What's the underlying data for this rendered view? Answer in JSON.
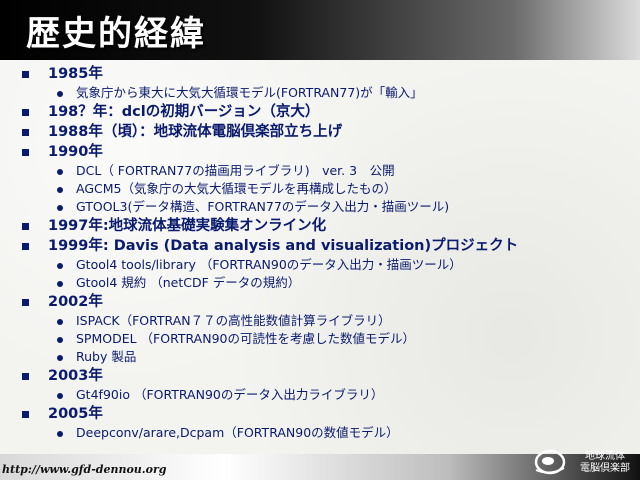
{
  "title": "歴史的経緯",
  "items": [
    {
      "label": "1985年",
      "sub": [
        "気象庁から東大に大気大循環モデル(FORTRAN77)が「輸入」"
      ]
    },
    {
      "label": "198？年：dclの初期バージョン（京大）",
      "sub": []
    },
    {
      "label": "1988年（頃）：地球流体電脳倶楽部立ち上げ",
      "sub": []
    },
    {
      "label": "1990年",
      "sub": [
        "DCL（ FORTRAN77の描画用ライブラリ)　ver. 3　公開",
        "AGCM5（気象庁の大気大循環モデルを再構成したもの）",
        "GTOOL3(データ構造、FORTRAN77のデータ入出力・描画ツール)"
      ]
    },
    {
      "label": "1997年:地球流体基礎実験集オンライン化",
      "sub": []
    },
    {
      "label": "1999年: Davis (Data analysis and visualization)プロジェクト",
      "sub": [
        "Gtool4 tools/library （FORTRAN90のデータ入出力・描画ツール）",
        "Gtool4 規約 （netCDF データの規約）"
      ]
    },
    {
      "label": "2002年",
      "sub": [
        "ISPACK（FORTRAN７７の高性能数値計算ライブラリ）",
        "SPMODEL （FORTRAN90の可読性を考慮した数値モデル）",
        "Ruby 製品"
      ]
    },
    {
      "label": "2003年",
      "sub": [
        "Gt4f90io （FORTRAN90のデータ入出力ライブラリ）"
      ]
    },
    {
      "label": "2005年",
      "sub": [
        "Deepconv/arare,Dcpam（FORTRAN90の数値モデル）"
      ]
    }
  ],
  "footer": {
    "url": "http://www.gfd-dennou.org",
    "logo_line1": "地球流体",
    "logo_line2": "電脳倶楽部"
  },
  "colors": {
    "text": "#0a1a6e",
    "title": "#ffffff"
  }
}
